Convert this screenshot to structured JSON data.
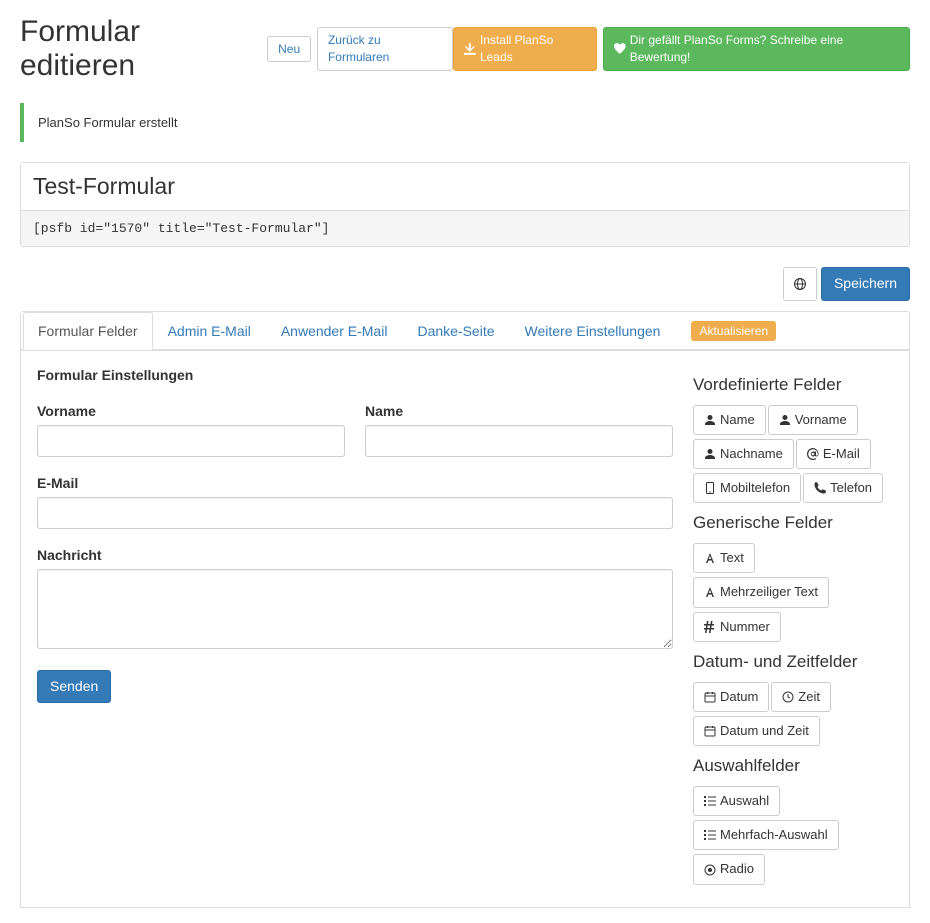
{
  "page_title": "Formular editieren",
  "header_buttons": {
    "new": "Neu",
    "back": "Zurück zu Formularen",
    "install": "Install PlanSo Leads",
    "review": "Dir gefällt PlanSo Forms? Schreibe eine Bewertung!"
  },
  "alert_message": "PlanSo Formular erstellt",
  "form_name": "Test-Formular",
  "shortcode": "[psfb id=\"1570\" title=\"Test-Formular\"]",
  "save_button": "Speichern",
  "tabs": [
    "Formular Felder",
    "Admin E-Mail",
    "Anwender E-Mail",
    "Danke-Seite",
    "Weitere Einstellungen"
  ],
  "update_badge": "Aktualisieren",
  "settings_heading": "Formular Einstellungen",
  "form_fields": {
    "vorname": "Vorname",
    "name": "Name",
    "email": "E-Mail",
    "nachricht": "Nachricht",
    "submit": "Senden"
  },
  "sidebar": {
    "predefined": {
      "heading": "Vordefinierte Felder",
      "items": [
        "Name",
        "Vorname",
        "Nachname",
        "E-Mail",
        "Mobiltelefon",
        "Telefon"
      ]
    },
    "generic": {
      "heading": "Generische Felder",
      "items": [
        "Text",
        "Mehrzeiliger Text",
        "Nummer"
      ]
    },
    "datetime": {
      "heading": "Datum- und Zeitfelder",
      "items": [
        "Datum",
        "Zeit",
        "Datum und Zeit"
      ]
    },
    "selection": {
      "heading": "Auswahlfelder",
      "items": [
        "Auswahl",
        "Mehrfach-Auswahl",
        "Radio"
      ]
    }
  }
}
